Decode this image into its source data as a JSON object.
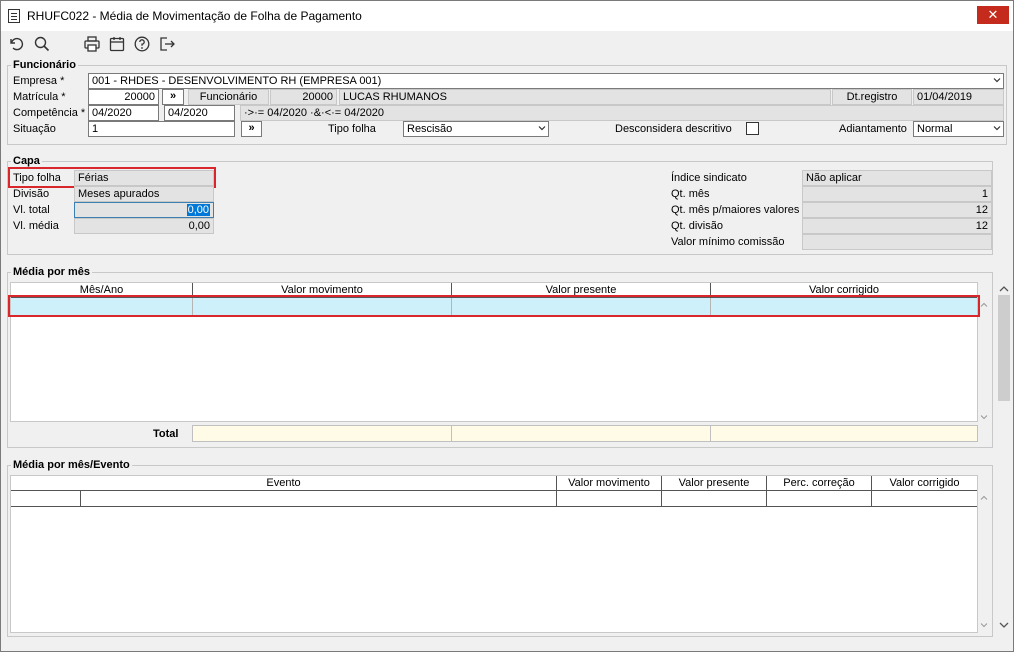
{
  "window": {
    "title": "RHUFC022 - Média de Movimentação de Folha de Pagamento",
    "close_symbol": "✕"
  },
  "toolbar": {
    "icons": [
      "refresh-icon",
      "search-icon",
      "print-icon",
      "calendar-icon",
      "help-icon",
      "exit-icon"
    ]
  },
  "funcionario": {
    "group_title": "Funcionário",
    "empresa_label": "Empresa *",
    "empresa_value": "001 - RHDES - DESENVOLVIMENTO RH (EMPRESA 001)",
    "matricula_label": "Matrícula *",
    "matricula_value": "20000",
    "matricula_btn": "»",
    "funcionario_label": "Funcionário",
    "funcionario_code": "20000",
    "funcionario_name": "LUCAS RHUMANOS",
    "dtregistro_label": "Dt.registro",
    "dtregistro_value": "01/04/2019",
    "competencia_label": "Competência *",
    "competencia_from": "04/2020",
    "competencia_to": "04/2020",
    "competencia_filter": "·>·= 04/2020 ·&·<·= 04/2020",
    "situacao_label": "Situação",
    "situacao_value": "1",
    "situacao_btn": "»",
    "tipofolha_label": "Tipo folha",
    "tipofolha_value": "Rescisão",
    "desconsidera_label": "Desconsidera descritivo",
    "adiantamento_label": "Adiantamento",
    "adiantamento_value": "Normal"
  },
  "capa": {
    "group_title": "Capa",
    "tipofolha_label": "Tipo folha",
    "tipofolha_value": "Férias",
    "divisao_label": "Divisão",
    "divisao_value": "Meses apurados",
    "vltotal_label": "Vl. total",
    "vltotal_value": "0,00",
    "vlmedia_label": "Vl. média",
    "vlmedia_value": "0,00",
    "indice_label": "Índice sindicato",
    "indice_value": "Não aplicar",
    "qtmes_label": "Qt. mês",
    "qtmes_value": "1",
    "qtmesmaiores_label": "Qt. mês p/maiores valores",
    "qtmesmaiores_value": "12",
    "qtdivisao_label": "Qt. divisão",
    "qtdivisao_value": "12",
    "valorminimo_label": "Valor mínimo comissão",
    "valorminimo_value": ""
  },
  "media_mes": {
    "group_title": "Média por mês",
    "columns": [
      "Mês/Ano",
      "Valor movimento",
      "Valor presente",
      "Valor corrigido"
    ],
    "total_label": "Total"
  },
  "media_evento": {
    "group_title": "Média por mês/Evento",
    "columns": [
      "Evento",
      "Valor movimento",
      "Valor presente",
      "Perc. correção",
      "Valor corrigido"
    ]
  }
}
